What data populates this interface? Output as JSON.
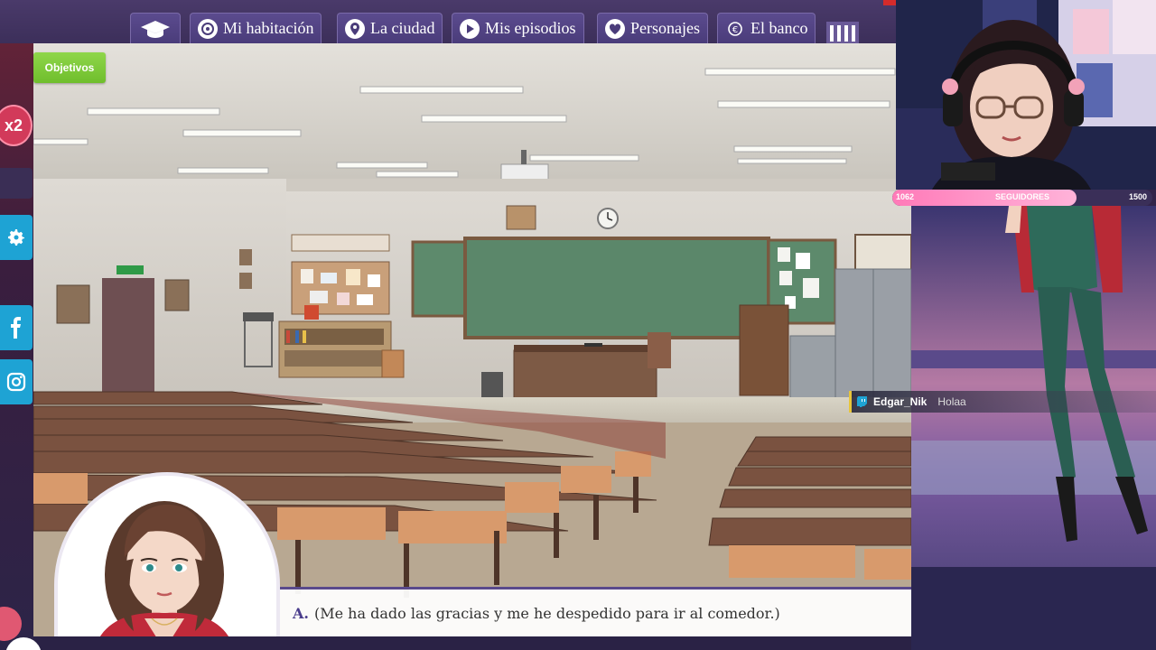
{
  "nav": {
    "home_icon": "graduation-cap-icon",
    "items": [
      {
        "label": "Mi habitación",
        "icon": "room-icon"
      },
      {
        "label": "La ciudad",
        "icon": "map-pin-icon"
      },
      {
        "label": "Mis episodios",
        "icon": "play-icon"
      },
      {
        "label": "Personajes",
        "icon": "heart-icon"
      },
      {
        "label": "El banco",
        "icon": "bank-icon"
      }
    ]
  },
  "objetivos_label": "Objetivos",
  "left_strip": {
    "multiplier": "x2",
    "buttons": [
      "settings-icon",
      "facebook-icon",
      "instagram-icon"
    ]
  },
  "dialogue": {
    "speaker": "A.",
    "text": "(Me ha dado las gracias y me he despedido para ir al comedor.)"
  },
  "stream": {
    "followers": {
      "current": "1062",
      "label": "SEGUIDORES",
      "goal": "1500",
      "progress": 0.708
    },
    "chat": {
      "user": "Edgar_Nik",
      "message": "Holaa"
    }
  },
  "colors": {
    "nav_bg": "#4a3c7a",
    "objetivos": "#7cc93a",
    "strip_button": "#1ea3d4",
    "badge": "#d23a5a",
    "followers_fill": "#ff8fc8"
  }
}
